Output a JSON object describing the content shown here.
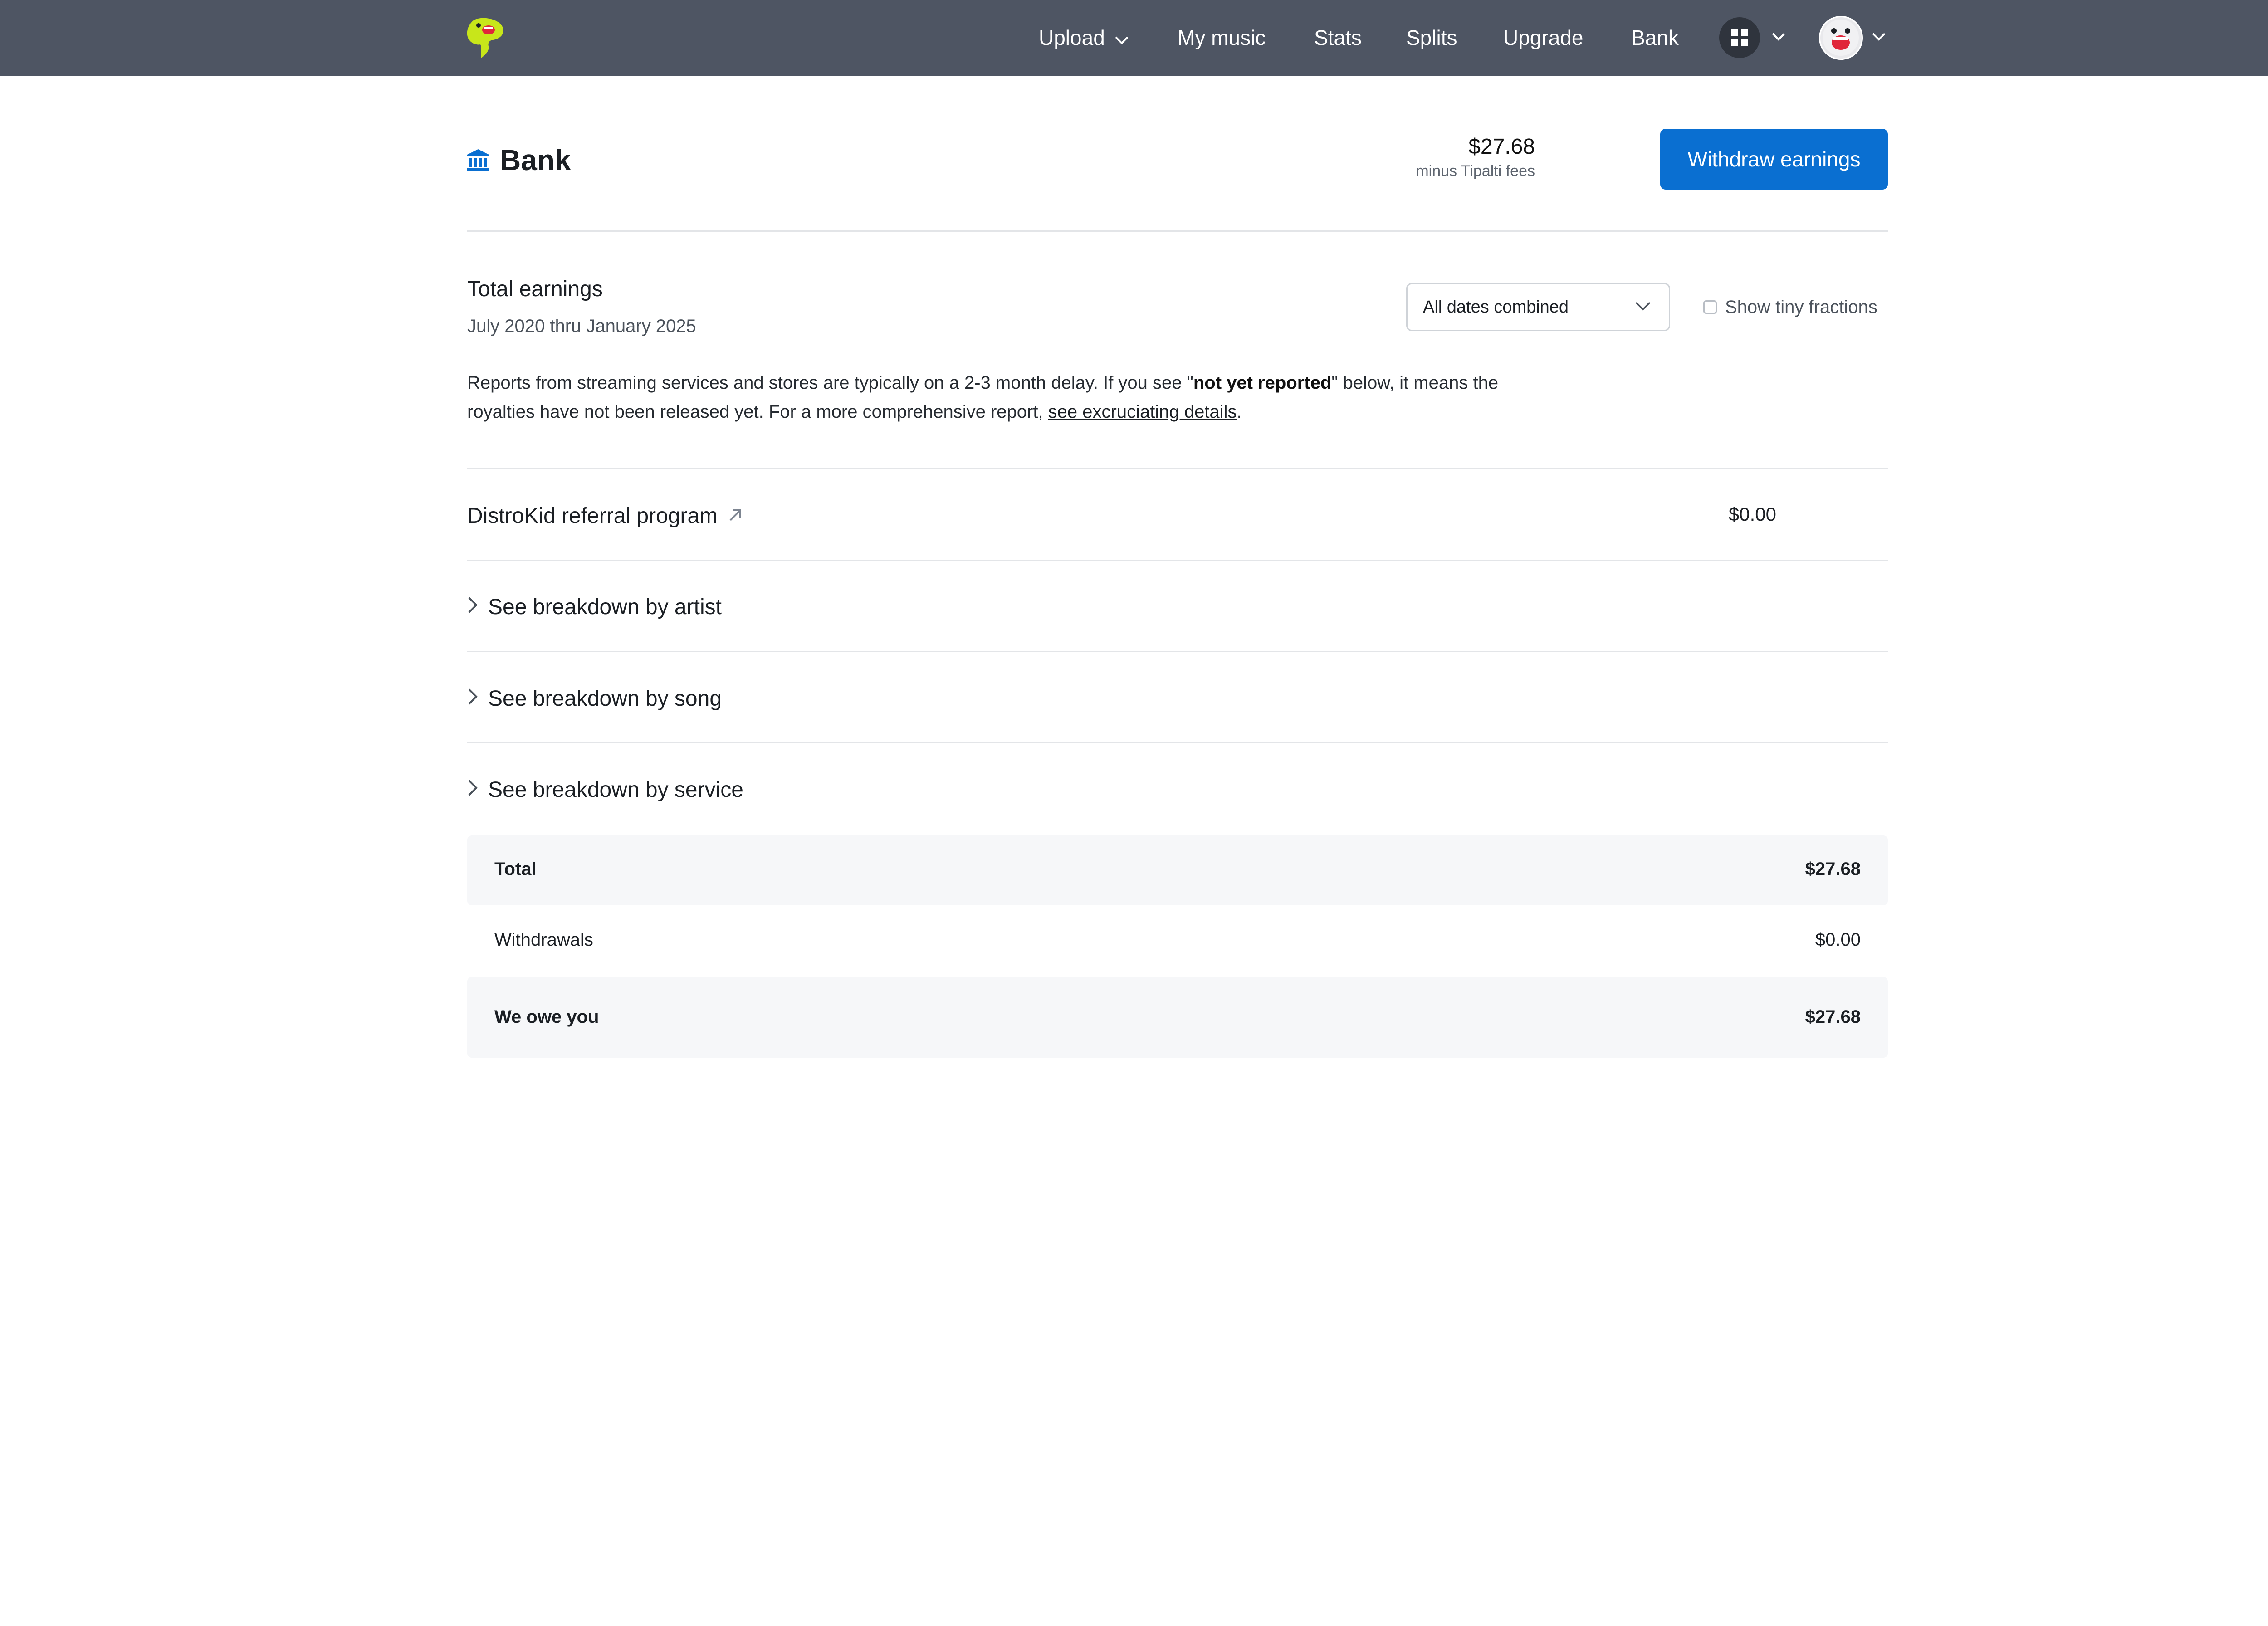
{
  "nav": {
    "items": [
      {
        "label": "Upload",
        "has_dropdown": true
      },
      {
        "label": "My music"
      },
      {
        "label": "Stats"
      },
      {
        "label": "Splits"
      },
      {
        "label": "Upgrade"
      },
      {
        "label": "Bank"
      }
    ],
    "icons": [
      "distrokid-logo",
      "apps-grid-icon",
      "avatar"
    ],
    "bar_color": "#4e5563",
    "logo_color": "#c8e61a"
  },
  "header": {
    "title": "Bank",
    "title_icon": "bank-icon",
    "balance": "$27.68",
    "balance_note": "minus Tipalti fees",
    "withdraw_label": "Withdraw earnings",
    "accent": "#0a6fd1"
  },
  "earnings": {
    "title": "Total earnings",
    "range": "July 2020 thru January 2025",
    "date_filter": "All dates combined",
    "tiny_fractions_label": "Show tiny fractions",
    "tiny_fractions_checked": false,
    "notice_part1": "Reports from streaming services and stores are typically on a 2-3 month delay. If you see \"",
    "notice_bold": "not yet reported",
    "notice_part2": "\" below, it means the royalties have not been released yet. For a more comprehensive report, ",
    "notice_link": "see excruciating details",
    "notice_end": "."
  },
  "referral": {
    "label": "DistroKid referral program",
    "amount": "$0.00"
  },
  "breakdowns": [
    {
      "label": "See breakdown by artist"
    },
    {
      "label": "See breakdown by song"
    },
    {
      "label": "See breakdown by service"
    }
  ],
  "totals": [
    {
      "label": "Total",
      "value": "$27.68"
    },
    {
      "label": "Withdrawals",
      "value": "$0.00"
    },
    {
      "label": "We owe you",
      "value": "$27.68"
    }
  ]
}
